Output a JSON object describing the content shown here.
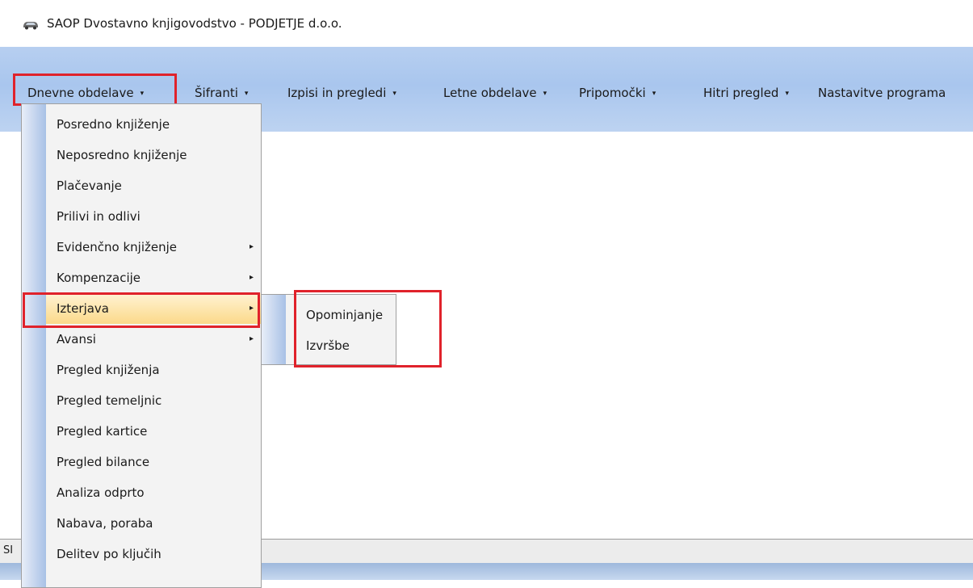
{
  "window": {
    "title": "SAOP Dvostavno knjigovodstvo - PODJETJE d.o.o.",
    "icon": "car-icon"
  },
  "menubar": {
    "items": [
      {
        "label": "Dnevne obdelave",
        "arrow": "▾",
        "highlighted": true
      },
      {
        "label": "Šifranti",
        "arrow": "▾"
      },
      {
        "label": "Izpisi in pregledi",
        "arrow": "▾"
      },
      {
        "label": "Letne obdelave",
        "arrow": "▾"
      },
      {
        "label": "Pripomočki",
        "arrow": "▾"
      },
      {
        "label": "Hitri pregled",
        "arrow": "▾"
      },
      {
        "label": "Nastavitve programa"
      }
    ]
  },
  "dropdown": {
    "items": [
      {
        "label": "Posredno knjiženje"
      },
      {
        "label": "Neposredno knjiženje"
      },
      {
        "label": "Plačevanje"
      },
      {
        "label": "Prilivi in odlivi"
      },
      {
        "label": "Evidenčno knjiženje",
        "submenu": "▸"
      },
      {
        "label": "Kompenzacije",
        "submenu": "▸"
      },
      {
        "label": "Izterjava",
        "submenu": "▸",
        "active": true
      },
      {
        "label": "Avansi",
        "submenu": "▸"
      },
      {
        "label": "Pregled knjiženja"
      },
      {
        "label": "Pregled temeljnic"
      },
      {
        "label": "Pregled kartice"
      },
      {
        "label": "Pregled bilance"
      },
      {
        "label": "Analiza odprto"
      },
      {
        "label": "Nabava, poraba"
      },
      {
        "label": "Delitev po ključih"
      }
    ]
  },
  "submenu": {
    "items": [
      {
        "label": "Opominjanje"
      },
      {
        "label": "Izvršbe"
      }
    ]
  },
  "statusbar": {
    "text": "SI"
  },
  "colors": {
    "highlight_box": "#e0222b",
    "menu_band": "#a9c6ee",
    "active_item": "#fbd98a"
  }
}
